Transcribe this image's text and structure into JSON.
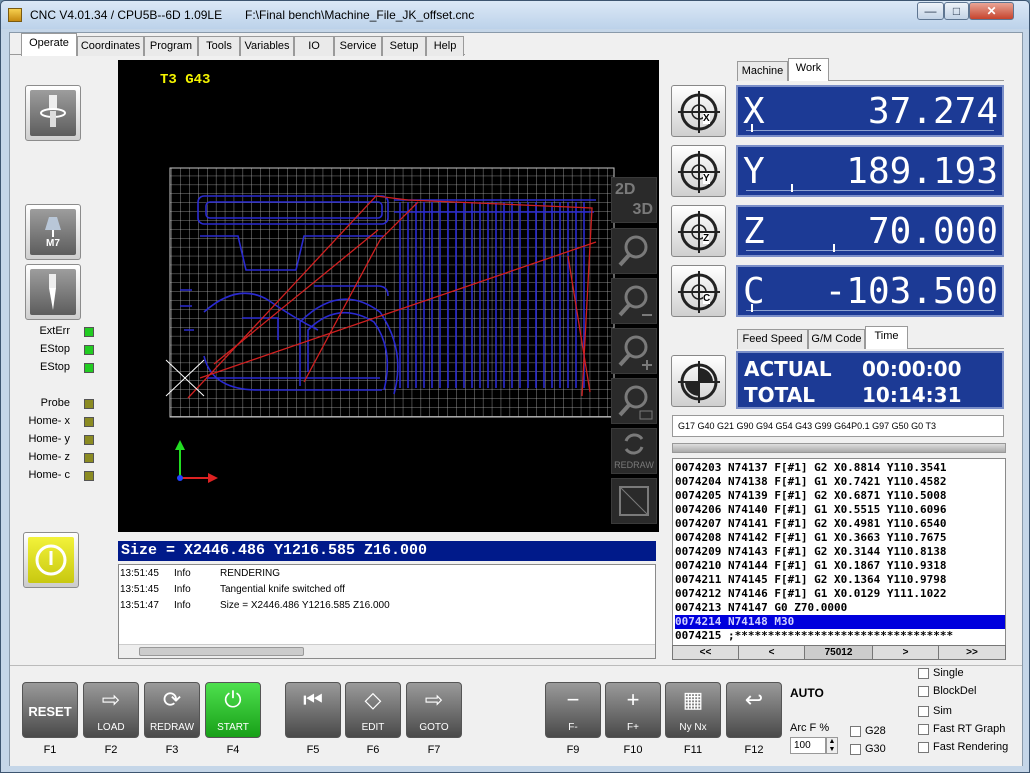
{
  "window": {
    "app_title": "CNC V4.01.34 / CPU5B--6D 1.09LE",
    "file_path": "F:\\Final bench\\Machine_File_JK_offset.cnc",
    "min": "—",
    "max": "□",
    "close": "✕"
  },
  "main_tabs": [
    "Operate",
    "Coordinates",
    "Program",
    "Tools",
    "Variables",
    "IO",
    "Service",
    "Setup",
    "Help"
  ],
  "status_leds": [
    {
      "label": "ExtErr",
      "color": "green"
    },
    {
      "label": "EStop",
      "color": "green"
    },
    {
      "label": "EStop",
      "color": "green"
    },
    {
      "label": "Probe",
      "color": "olive"
    },
    {
      "label": "Home- x",
      "color": "olive"
    },
    {
      "label": "Home- y",
      "color": "olive"
    },
    {
      "label": "Home- z",
      "color": "olive"
    },
    {
      "label": "Home- c",
      "color": "olive"
    }
  ],
  "left_buttons": {
    "m7_label": "M7"
  },
  "viewport": {
    "tool_info": "T3 G43",
    "view_2d": "2D",
    "view_3d": "3D",
    "redraw": "REDRAW"
  },
  "size_line": "Size = X2446.486 Y1216.585 Z16.000",
  "log": [
    {
      "time": "13:51:45",
      "level": "Info",
      "msg": "RENDERING"
    },
    {
      "time": "13:51:45",
      "level": "Info",
      "msg": "Tangential knife switched off"
    },
    {
      "time": "13:51:47",
      "level": "Info",
      "msg": "Size = X2446.486 Y1216.585 Z16.000"
    }
  ],
  "coord_tabs": [
    "Machine",
    "Work"
  ],
  "axes": [
    {
      "name": "X",
      "value": "37.274",
      "badge": "X",
      "level": 0.02
    },
    {
      "name": "Y",
      "value": "189.193",
      "badge": "Y",
      "level": 0.18
    },
    {
      "name": "Z",
      "value": "70.000",
      "badge": "Z",
      "level": 0.35
    },
    {
      "name": "C",
      "value": "-103.500",
      "badge": "C",
      "level": 0.02
    }
  ],
  "info_tabs": [
    "Feed Speed",
    "G/M Code",
    "Time"
  ],
  "time": {
    "actual_label": "ACTUAL",
    "actual": "00:00:00",
    "total_label": "TOTAL",
    "total": "10:14:31"
  },
  "g_modal": "G17 G40 G21 G90 G94 G54 G43 G99 G64P0.1 G97 G50 G0 T3",
  "program_lines": [
    "0074203 N74137 F[#1] G2 X0.8814 Y110.3541",
    "0074204 N74138 F[#1] G1 X0.7421 Y110.4582",
    "0074205 N74139 F[#1] G2 X0.6871 Y110.5008",
    "0074206 N74140 F[#1] G1 X0.5515 Y110.6096",
    "0074207 N74141 F[#1] G2 X0.4981 Y110.6540",
    "0074208 N74142 F[#1] G1 X0.3663 Y110.7675",
    "0074209 N74143 F[#1] G2 X0.3144 Y110.8138",
    "0074210 N74144 F[#1] G1 X0.1867 Y110.9318",
    "0074211 N74145 F[#1] G2 X0.1364 Y110.9798",
    "0074212 N74146 F[#1] G1 X0.0129 Y111.1022",
    "0074213 N74147 G0 Z70.0000",
    "0074214 N74148 M30",
    "0074215 ;*********************************"
  ],
  "program_selected_index": 11,
  "program_nav": {
    "first": "<<",
    "prev": "<",
    "line": "75012",
    "next": ">",
    "last": ">>"
  },
  "fkeys": [
    {
      "label": "RESET",
      "key": "F1"
    },
    {
      "label": "LOAD",
      "key": "F2"
    },
    {
      "label": "REDRAW",
      "key": "F3"
    },
    {
      "label": "START",
      "key": "F4"
    },
    {
      "label": "",
      "key": "F5"
    },
    {
      "label": "EDIT",
      "key": "F6"
    },
    {
      "label": "GOTO",
      "key": "F7"
    },
    {
      "label": "F-",
      "key": "F9"
    },
    {
      "label": "F+",
      "key": "F10"
    },
    {
      "label": "Ny Nx",
      "key": "F11"
    },
    {
      "label": "",
      "key": "F12"
    }
  ],
  "mode": "AUTO",
  "arc_f": {
    "label": "Arc F %",
    "value": "100"
  },
  "checkboxes": {
    "g28": "G28",
    "g30": "G30",
    "single": "Single",
    "blockdel": "BlockDel",
    "sim": "Sim",
    "fast_rt_graph": "Fast RT Graph",
    "fast_rendering": "Fast Rendering"
  },
  "colors": {
    "axis_bg": "#1c3a95",
    "start_green": "#22b022",
    "led_green": "#22cc22",
    "led_olive": "#8b8b22",
    "toolpath_blue": "#2a2ad0",
    "toolpath_red": "#d02020",
    "grid": "#b8b8b8"
  }
}
